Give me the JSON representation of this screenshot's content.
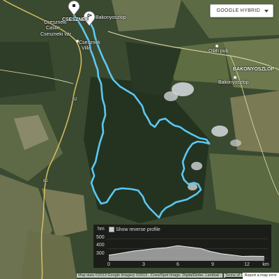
{
  "map": {
    "type_button_label": "GOOGLE HYBRID",
    "places": [
      {
        "name": "CSESZNEK",
        "kind": "village"
      },
      {
        "name": "Cseszneki",
        "kind": "place"
      },
      {
        "name": "Castle",
        "kind": "place"
      },
      {
        "name": "Cseszneki vár",
        "kind": "place"
      },
      {
        "name": "Oláh pub",
        "kind": "place"
      },
      {
        "name": "BAKONYOSZLOP",
        "kind": "village"
      },
      {
        "name": "Bakonyoszlop",
        "kind": "place"
      },
      {
        "name": "Mindszenty",
        "kind": "place"
      },
      {
        "name": "Csesznek",
        "kind": "place"
      },
      {
        "name": "Villa",
        "kind": "place"
      }
    ],
    "roads": [
      "82",
      "82"
    ],
    "markers": [
      {
        "name": "start-marker",
        "kind": "start"
      },
      {
        "name": "finish-marker",
        "kind": "finish"
      }
    ],
    "route_color": "#5bc8f5"
  },
  "elevation_panel": {
    "y_unit": "hm",
    "toggle_label": "Show reverse profile",
    "y_ticks": [
      "500",
      "400",
      "300"
    ],
    "x_ticks": [
      "0",
      "3",
      "6",
      "9",
      "12"
    ],
    "x_unit": "km",
    "profile": [
      {
        "km": 0,
        "m": 330
      },
      {
        "km": 0.8,
        "m": 345
      },
      {
        "km": 1.5,
        "m": 360
      },
      {
        "km": 2.2,
        "m": 375
      },
      {
        "km": 3.0,
        "m": 385
      },
      {
        "km": 4.0,
        "m": 400
      },
      {
        "km": 5.0,
        "m": 410
      },
      {
        "km": 6.0,
        "m": 430
      },
      {
        "km": 7.0,
        "m": 415
      },
      {
        "km": 8.0,
        "m": 400
      },
      {
        "km": 8.8,
        "m": 370
      },
      {
        "km": 9.8,
        "m": 345
      },
      {
        "km": 10.8,
        "m": 330
      },
      {
        "km": 11.6,
        "m": 318
      },
      {
        "km": 12.4,
        "m": 320
      },
      {
        "km": 13.5,
        "m": 318
      }
    ]
  },
  "footer": {
    "attribution": "Map data ©2013 Google Imagery ©2013 , Cnes/Spot Image, DigitalGlobe, Landsat -",
    "terms": "Terms of Use",
    "report": "Report a map error"
  }
}
